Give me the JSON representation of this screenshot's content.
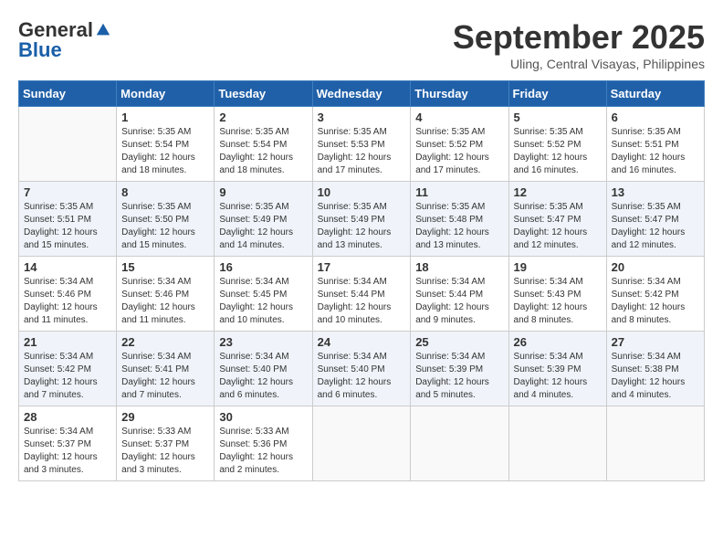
{
  "header": {
    "logo_general": "General",
    "logo_blue": "Blue",
    "month": "September 2025",
    "location": "Uling, Central Visayas, Philippines"
  },
  "days_of_week": [
    "Sunday",
    "Monday",
    "Tuesday",
    "Wednesday",
    "Thursday",
    "Friday",
    "Saturday"
  ],
  "weeks": [
    [
      {
        "day": "",
        "info": ""
      },
      {
        "day": "1",
        "info": "Sunrise: 5:35 AM\nSunset: 5:54 PM\nDaylight: 12 hours\nand 18 minutes."
      },
      {
        "day": "2",
        "info": "Sunrise: 5:35 AM\nSunset: 5:54 PM\nDaylight: 12 hours\nand 18 minutes."
      },
      {
        "day": "3",
        "info": "Sunrise: 5:35 AM\nSunset: 5:53 PM\nDaylight: 12 hours\nand 17 minutes."
      },
      {
        "day": "4",
        "info": "Sunrise: 5:35 AM\nSunset: 5:52 PM\nDaylight: 12 hours\nand 17 minutes."
      },
      {
        "day": "5",
        "info": "Sunrise: 5:35 AM\nSunset: 5:52 PM\nDaylight: 12 hours\nand 16 minutes."
      },
      {
        "day": "6",
        "info": "Sunrise: 5:35 AM\nSunset: 5:51 PM\nDaylight: 12 hours\nand 16 minutes."
      }
    ],
    [
      {
        "day": "7",
        "info": "Sunrise: 5:35 AM\nSunset: 5:51 PM\nDaylight: 12 hours\nand 15 minutes."
      },
      {
        "day": "8",
        "info": "Sunrise: 5:35 AM\nSunset: 5:50 PM\nDaylight: 12 hours\nand 15 minutes."
      },
      {
        "day": "9",
        "info": "Sunrise: 5:35 AM\nSunset: 5:49 PM\nDaylight: 12 hours\nand 14 minutes."
      },
      {
        "day": "10",
        "info": "Sunrise: 5:35 AM\nSunset: 5:49 PM\nDaylight: 12 hours\nand 13 minutes."
      },
      {
        "day": "11",
        "info": "Sunrise: 5:35 AM\nSunset: 5:48 PM\nDaylight: 12 hours\nand 13 minutes."
      },
      {
        "day": "12",
        "info": "Sunrise: 5:35 AM\nSunset: 5:47 PM\nDaylight: 12 hours\nand 12 minutes."
      },
      {
        "day": "13",
        "info": "Sunrise: 5:35 AM\nSunset: 5:47 PM\nDaylight: 12 hours\nand 12 minutes."
      }
    ],
    [
      {
        "day": "14",
        "info": "Sunrise: 5:34 AM\nSunset: 5:46 PM\nDaylight: 12 hours\nand 11 minutes."
      },
      {
        "day": "15",
        "info": "Sunrise: 5:34 AM\nSunset: 5:46 PM\nDaylight: 12 hours\nand 11 minutes."
      },
      {
        "day": "16",
        "info": "Sunrise: 5:34 AM\nSunset: 5:45 PM\nDaylight: 12 hours\nand 10 minutes."
      },
      {
        "day": "17",
        "info": "Sunrise: 5:34 AM\nSunset: 5:44 PM\nDaylight: 12 hours\nand 10 minutes."
      },
      {
        "day": "18",
        "info": "Sunrise: 5:34 AM\nSunset: 5:44 PM\nDaylight: 12 hours\nand 9 minutes."
      },
      {
        "day": "19",
        "info": "Sunrise: 5:34 AM\nSunset: 5:43 PM\nDaylight: 12 hours\nand 8 minutes."
      },
      {
        "day": "20",
        "info": "Sunrise: 5:34 AM\nSunset: 5:42 PM\nDaylight: 12 hours\nand 8 minutes."
      }
    ],
    [
      {
        "day": "21",
        "info": "Sunrise: 5:34 AM\nSunset: 5:42 PM\nDaylight: 12 hours\nand 7 minutes."
      },
      {
        "day": "22",
        "info": "Sunrise: 5:34 AM\nSunset: 5:41 PM\nDaylight: 12 hours\nand 7 minutes."
      },
      {
        "day": "23",
        "info": "Sunrise: 5:34 AM\nSunset: 5:40 PM\nDaylight: 12 hours\nand 6 minutes."
      },
      {
        "day": "24",
        "info": "Sunrise: 5:34 AM\nSunset: 5:40 PM\nDaylight: 12 hours\nand 6 minutes."
      },
      {
        "day": "25",
        "info": "Sunrise: 5:34 AM\nSunset: 5:39 PM\nDaylight: 12 hours\nand 5 minutes."
      },
      {
        "day": "26",
        "info": "Sunrise: 5:34 AM\nSunset: 5:39 PM\nDaylight: 12 hours\nand 4 minutes."
      },
      {
        "day": "27",
        "info": "Sunrise: 5:34 AM\nSunset: 5:38 PM\nDaylight: 12 hours\nand 4 minutes."
      }
    ],
    [
      {
        "day": "28",
        "info": "Sunrise: 5:34 AM\nSunset: 5:37 PM\nDaylight: 12 hours\nand 3 minutes."
      },
      {
        "day": "29",
        "info": "Sunrise: 5:33 AM\nSunset: 5:37 PM\nDaylight: 12 hours\nand 3 minutes."
      },
      {
        "day": "30",
        "info": "Sunrise: 5:33 AM\nSunset: 5:36 PM\nDaylight: 12 hours\nand 2 minutes."
      },
      {
        "day": "",
        "info": ""
      },
      {
        "day": "",
        "info": ""
      },
      {
        "day": "",
        "info": ""
      },
      {
        "day": "",
        "info": ""
      }
    ]
  ]
}
